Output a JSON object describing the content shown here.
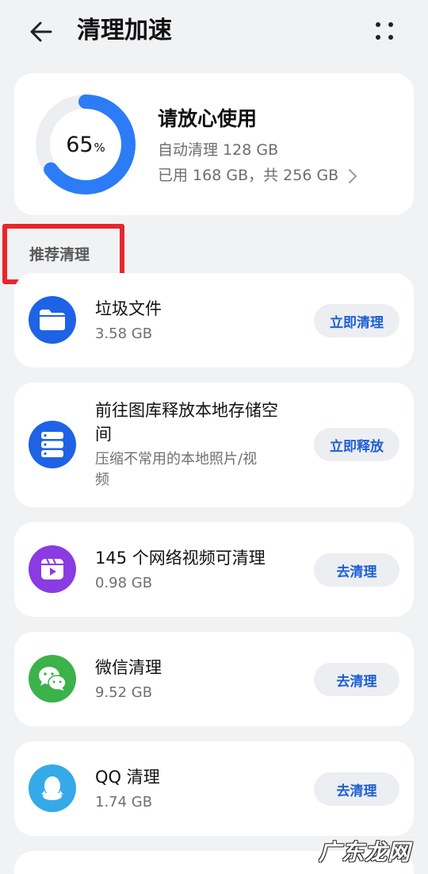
{
  "header": {
    "title": "清理加速",
    "back_icon": "arrow-left-icon",
    "more_icon": "more-dots-icon"
  },
  "storage": {
    "percent_value": "65",
    "percent_unit": "%",
    "used_fraction": 0.65,
    "ring_color": "#2b7cf6",
    "title": "请放心使用",
    "auto_clean": "自动清理 128 GB",
    "usage": "已用 168 GB，共 256 GB"
  },
  "section": {
    "title": "推荐清理"
  },
  "items": [
    {
      "title": "垃圾文件",
      "subtitle": "3.58 GB",
      "action": "立即清理",
      "icon": "folder-icon",
      "color": "#1e62e6"
    },
    {
      "title_line1": "前往图库释放本地存储空",
      "title_line2": "间",
      "subtitle_line1": "压缩不常用的本地照片/视",
      "subtitle_line2": "频",
      "action": "立即释放",
      "icon": "storage-stack-icon",
      "color": "#1e62e6"
    },
    {
      "title": "145 个网络视频可清理",
      "subtitle": "0.98 GB",
      "action": "去清理",
      "icon": "video-clapper-icon",
      "color": "#8b3be2"
    },
    {
      "title": "微信清理",
      "subtitle": "9.52 GB",
      "action": "去清理",
      "icon": "wechat-icon",
      "color": "#3cb24a"
    },
    {
      "title": "QQ 清理",
      "subtitle": "1.74 GB",
      "action": "去清理",
      "icon": "qq-penguin-icon",
      "color": "#36a9e8"
    }
  ],
  "watermark": {
    "text": "广东龙网"
  }
}
